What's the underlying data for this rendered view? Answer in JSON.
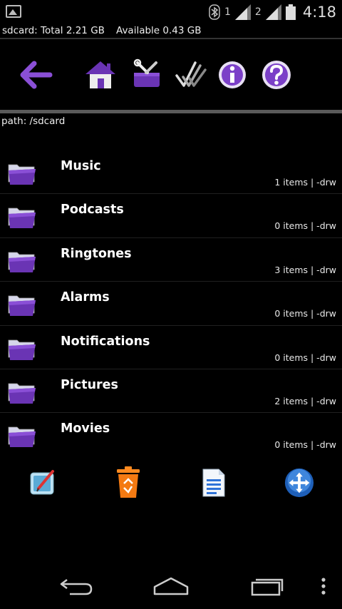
{
  "status": {
    "sim1": "1",
    "sim2": "2",
    "time": "4:18"
  },
  "storage": {
    "total": "sdcard: Total 2.21 GB",
    "available": "Available 0.43 GB"
  },
  "path": "path: /sdcard",
  "colors": {
    "accent": "#7b3fc8",
    "folder_front": "#6a34b4",
    "folder_back": "#cfcfe8"
  },
  "folders": [
    {
      "name": "Music",
      "meta": "1 items | -drw"
    },
    {
      "name": "Podcasts",
      "meta": "0 items | -drw"
    },
    {
      "name": "Ringtones",
      "meta": "3 items | -drw"
    },
    {
      "name": "Alarms",
      "meta": "0 items | -drw"
    },
    {
      "name": "Notifications",
      "meta": "0 items | -drw"
    },
    {
      "name": "Pictures",
      "meta": "2 items | -drw"
    },
    {
      "name": "Movies",
      "meta": "0 items | -drw"
    }
  ]
}
